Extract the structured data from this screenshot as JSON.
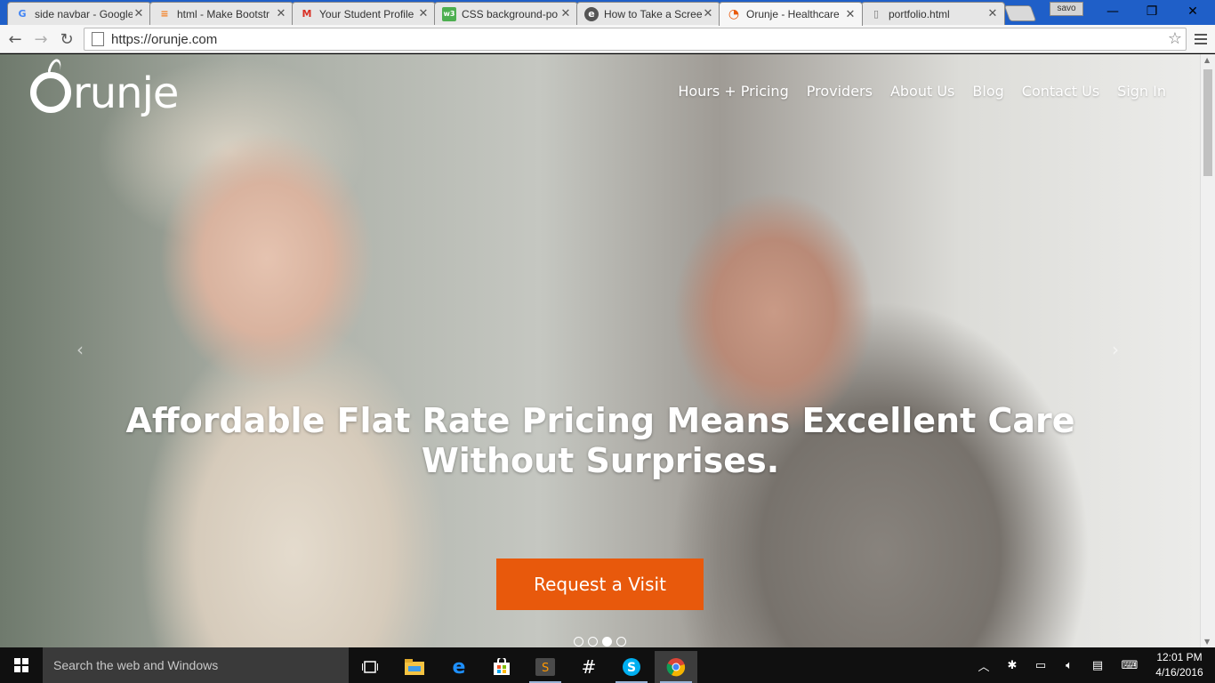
{
  "browser": {
    "tabs": [
      {
        "title": "side navbar - Google",
        "favicon": "google-g-icon",
        "color": "#4285f4",
        "glyph": "G"
      },
      {
        "title": "html - Make Bootstr",
        "favicon": "stackoverflow-icon",
        "color": "#f48024",
        "glyph": "≡"
      },
      {
        "title": "Your Student Profile",
        "favicon": "gmail-icon",
        "color": "#d93025",
        "glyph": "M"
      },
      {
        "title": "CSS background-po",
        "favicon": "w3schools-icon",
        "color": "#4caf50",
        "glyph": "w3"
      },
      {
        "title": "How to Take a Scree",
        "favicon": "howto-icon",
        "color": "#555555",
        "glyph": "e"
      },
      {
        "title": "Orunje - Healthcare",
        "favicon": "orunje-icon",
        "color": "#e8590c",
        "glyph": "◔"
      },
      {
        "title": "portfolio.html",
        "favicon": "file-icon",
        "color": "#777777",
        "glyph": "▯"
      }
    ],
    "profile_name": "savo",
    "url": "https://orunje.com"
  },
  "page": {
    "logo_text": "runje",
    "nav": [
      "Hours + Pricing",
      "Providers",
      "About Us",
      "Blog",
      "Contact Us",
      "Sign In"
    ],
    "headline": "Affordable Flat Rate Pricing Means Excellent Care Without Surprises.",
    "cta_label": "Request a Visit",
    "carousel_slide": 3,
    "carousel_total": 4,
    "accent": "#e8590c"
  },
  "taskbar": {
    "search_placeholder": "Search the web and Windows",
    "time": "12:01 PM",
    "date": "4/16/2016"
  }
}
